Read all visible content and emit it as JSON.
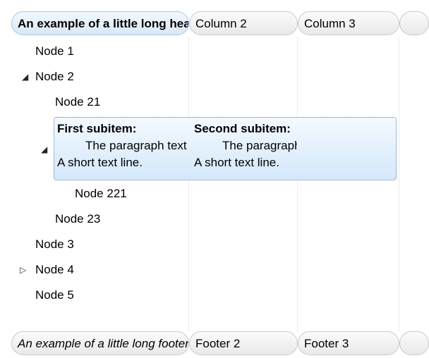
{
  "header": {
    "col1": "An example of a little long header",
    "col2": "Column 2",
    "col3": "Column 3",
    "col4": ""
  },
  "footer": {
    "col1": "An example of a little long footer",
    "col2": "Footer 2",
    "col3": "Footer 3",
    "col4": ""
  },
  "nodes": {
    "node1": "Node 1",
    "node2": "Node 2",
    "node21": "Node 21",
    "node221": "Node 221",
    "node23": "Node 23",
    "node3": "Node 3",
    "node4": "Node 4",
    "node5": "Node 5"
  },
  "selected": {
    "sub1_title": "First subitem:",
    "sub1_para": "The paragraph text",
    "sub1_line": "A short text line.",
    "sub2_title": "Second subitem:",
    "sub2_para": "The paragraph text",
    "sub2_line": "A short text line."
  },
  "icons": {
    "expanded": "◢",
    "collapsed": "▷"
  }
}
